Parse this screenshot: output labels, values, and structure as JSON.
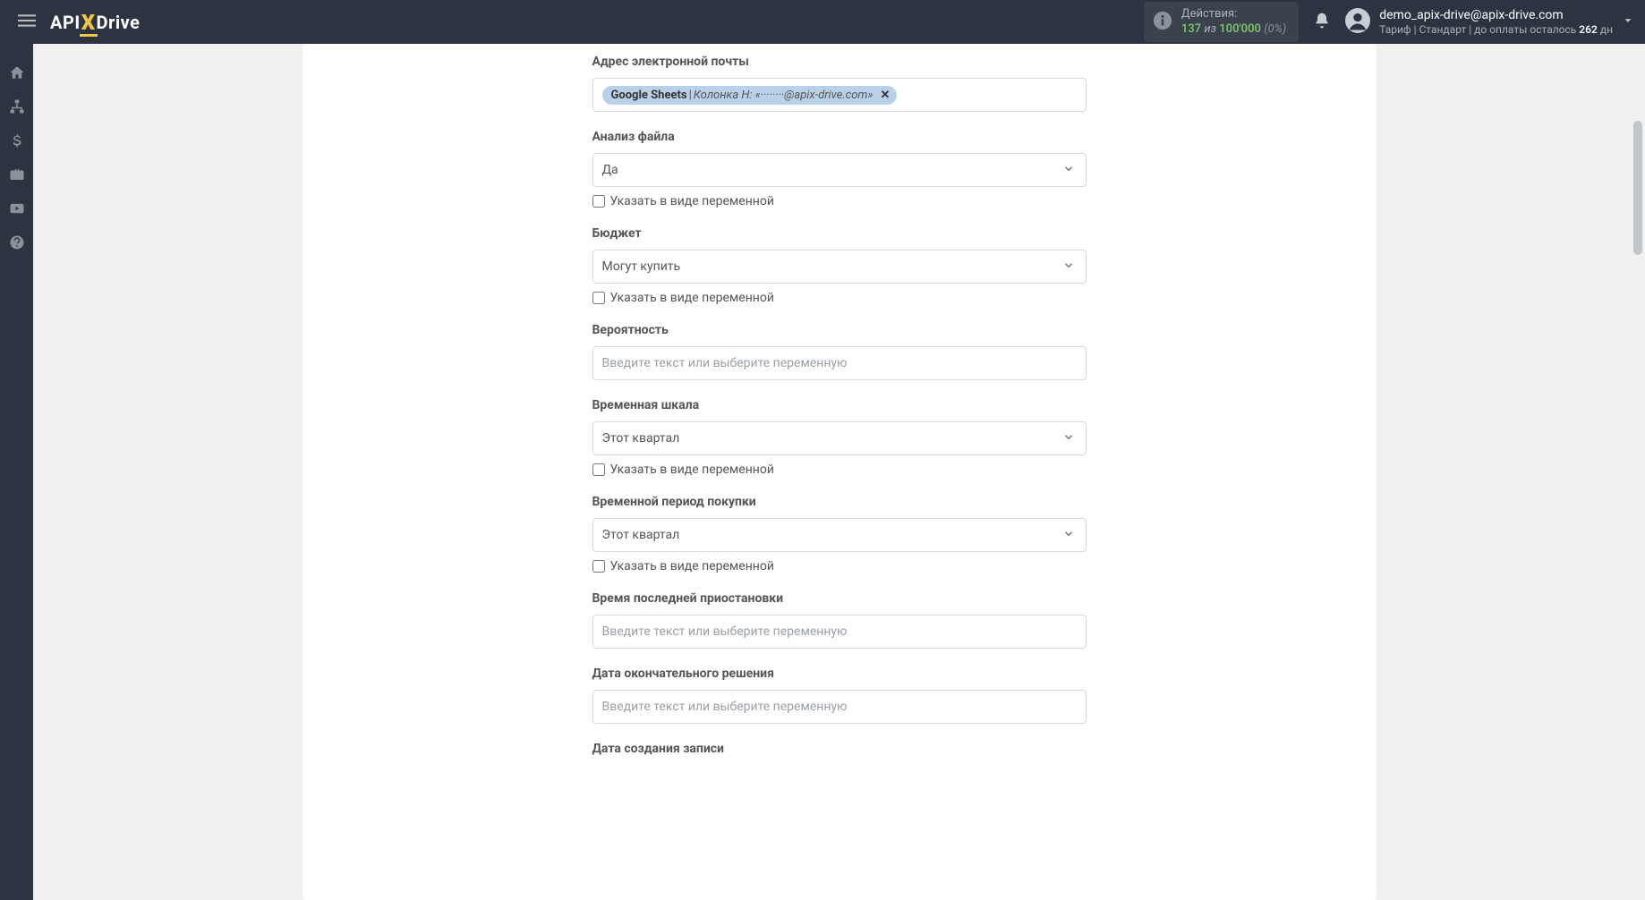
{
  "header": {
    "logo": {
      "api": "API",
      "x": "X",
      "drive": "Drive"
    },
    "actions": {
      "label": "Действия:",
      "used": "137",
      "of": "из",
      "total": "100'000",
      "pct": "(0%)"
    },
    "user": {
      "email": "demo_apix-drive@apix-drive.com",
      "tariff_prefix": "Тариф | Стандарт | до оплаты осталось ",
      "days": "262",
      "days_suffix": " дн"
    }
  },
  "form": {
    "placeholder_text": "Введите текст или выберите переменную",
    "variable_checkbox_label": "Указать в виде переменной",
    "fields": {
      "email": {
        "label": "Адрес электронной почты",
        "tag_source": "Google Sheets",
        "tag_sep": " | ",
        "tag_col": "Колонка H: «········@apix-drive.com»"
      },
      "file_analysis": {
        "label": "Анализ файла",
        "value": "Да"
      },
      "budget": {
        "label": "Бюджет",
        "value": "Могут купить"
      },
      "probability": {
        "label": "Вероятность"
      },
      "timescale": {
        "label": "Временная шкала",
        "value": "Этот квартал"
      },
      "purchase_period": {
        "label": "Временной период покупки",
        "value": "Этот квартал"
      },
      "last_pause": {
        "label": "Время последней приостановки"
      },
      "final_decision_date": {
        "label": "Дата окончательного решения"
      },
      "record_created_date": {
        "label": "Дата создания записи"
      }
    }
  }
}
